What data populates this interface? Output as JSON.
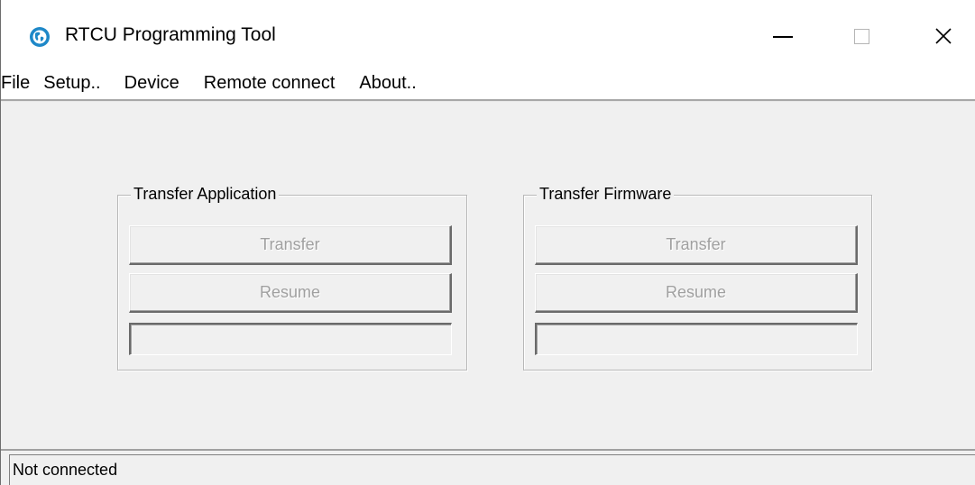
{
  "window": {
    "title": "RTCU Programming Tool",
    "icon": "rtcu-globe-icon"
  },
  "title_buttons": {
    "minimize": "—",
    "maximize": "☐",
    "close": "✕"
  },
  "menu": {
    "items": [
      {
        "label": "File"
      },
      {
        "label": "Setup.."
      },
      {
        "label": "Device"
      },
      {
        "label": "Remote connect"
      },
      {
        "label": "About.."
      }
    ]
  },
  "groups": {
    "application": {
      "title": "Transfer Application",
      "transfer_label": "Transfer",
      "resume_label": "Resume",
      "enabled": false,
      "progress": 0
    },
    "firmware": {
      "title": "Transfer Firmware",
      "transfer_label": "Transfer",
      "resume_label": "Resume",
      "enabled": false,
      "progress": 0
    }
  },
  "status": {
    "text": "Not connected"
  },
  "colors": {
    "client_bg": "#f0f0f0",
    "icon_blue": "#1e88c8",
    "disabled_text": "#a0a0a0"
  }
}
